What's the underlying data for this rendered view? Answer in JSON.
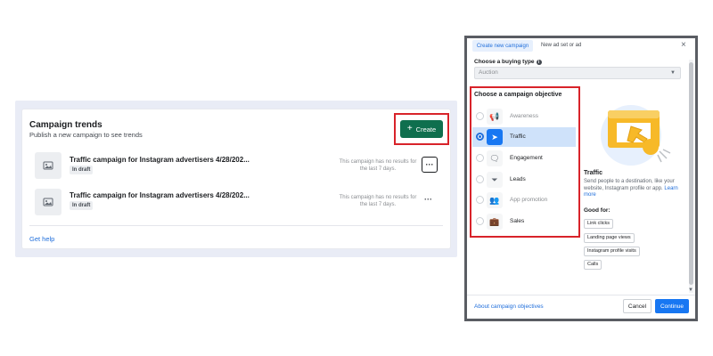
{
  "campaign_trends": {
    "title": "Campaign trends",
    "subtitle": "Publish a new campaign to see trends",
    "create_label": "Create",
    "rows": [
      {
        "title": "Traffic campaign for Instagram advertisers 4/28/202...",
        "status": "In draft",
        "note": "This campaign has no results for the last 7 days."
      },
      {
        "title": "Traffic campaign for Instagram advertisers 4/28/202...",
        "status": "In draft",
        "note": "This campaign has no results for the last 7 days."
      }
    ],
    "more_label": "···",
    "get_help": "Get help"
  },
  "dialog": {
    "tabs": {
      "active": "Create new campaign",
      "other": "New ad set or ad"
    },
    "close": "×",
    "buying_type": {
      "label": "Choose a buying type",
      "info": "i",
      "value": "Auction"
    },
    "objective_title": "Choose a campaign objective",
    "objectives": [
      {
        "label": "Awareness",
        "icon": "megaphone-icon",
        "glyph": "📢",
        "selected": false,
        "dim": true
      },
      {
        "label": "Traffic",
        "icon": "cursor-icon",
        "glyph": "➤",
        "selected": true,
        "dim": false
      },
      {
        "label": "Engagement",
        "icon": "chat-icon",
        "glyph": "🗨",
        "selected": false,
        "dim": false
      },
      {
        "label": "Leads",
        "icon": "funnel-icon",
        "glyph": "⏷",
        "selected": false,
        "dim": false
      },
      {
        "label": "App promotion",
        "icon": "people-icon",
        "glyph": "👥",
        "selected": false,
        "dim": true
      },
      {
        "label": "Sales",
        "icon": "briefcase-icon",
        "glyph": "💼",
        "selected": false,
        "dim": false
      }
    ],
    "detail": {
      "title": "Traffic",
      "description": "Send people to a destination, like your website, Instagram profile or app.",
      "learn_more": "Learn more",
      "good_for_label": "Good for:",
      "good_for": [
        "Link clicks",
        "Landing page views",
        "Instagram profile visits",
        "Calls"
      ]
    },
    "about_link": "About campaign objectives",
    "cancel": "Cancel",
    "continue": "Continue"
  },
  "colors": {
    "create_green": "#0f6f4e",
    "highlight_red": "#d8232a",
    "brand_blue": "#1877f2",
    "selected_bg": "#cfe2fa",
    "illustration_yellow": "#f7b928"
  }
}
